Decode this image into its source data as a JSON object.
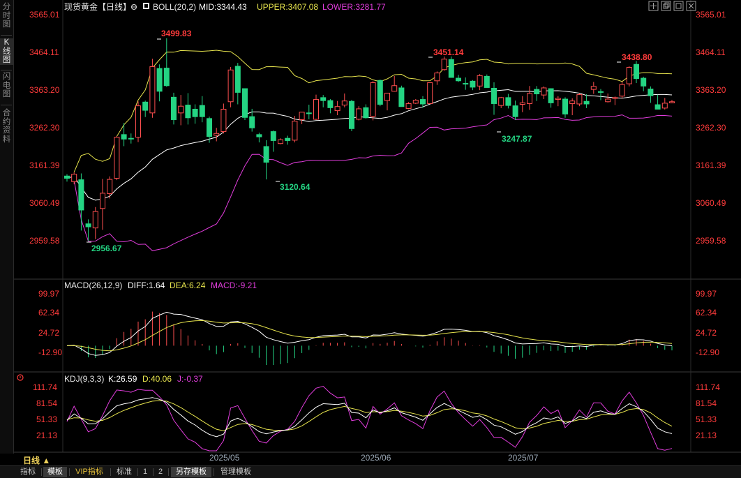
{
  "sidebar": {
    "tabs": [
      {
        "label": "分时图",
        "active": false
      },
      {
        "label": "K线图",
        "active": true
      },
      {
        "label": "闪电图",
        "active": false
      },
      {
        "label": "合约资料",
        "active": false
      }
    ]
  },
  "period_selector": "日线 ▲",
  "bottom_tabs": [
    {
      "label": "指标",
      "selected": false,
      "vip": false
    },
    {
      "label": "模板",
      "selected": true,
      "vip": false
    },
    {
      "label": "VIP指标",
      "selected": false,
      "vip": true
    },
    {
      "label": "标准",
      "selected": false,
      "vip": false
    },
    {
      "label": "1",
      "selected": false,
      "vip": false
    },
    {
      "label": "2",
      "selected": false,
      "vip": false
    },
    {
      "label": "另存模板",
      "selected": true,
      "vip": false
    },
    {
      "label": "管理模板",
      "selected": false,
      "vip": false
    }
  ],
  "window_controls": [
    "crosshair-icon",
    "restore-icon",
    "maximize-icon",
    "close-icon"
  ],
  "colors": {
    "up": "#ff4f4f",
    "down": "#24d483",
    "mid": "#ffffff",
    "upper": "#e6e34d",
    "lower": "#e13ddc",
    "axis_label": "#ff3b3b",
    "date_label": "#9aa7b4"
  },
  "main_panel": {
    "title": "现货黄金【日线】",
    "indicator_name": "BOLL(20,2)",
    "mid_label": "MID:3344.43",
    "upper_label": "UPPER:3407.08",
    "lower_label": "LOWER:3281.77",
    "y_ticks": [
      "3565.01",
      "3464.11",
      "3363.20",
      "3262.30",
      "3161.39",
      "3060.49",
      "2959.58"
    ],
    "annotations": [
      "3499.83",
      "2956.67",
      "3120.64",
      "3451.14",
      "3247.87",
      "3438.80"
    ]
  },
  "macd_panel": {
    "name": "MACD(26,12,9)",
    "diff_label": "DIFF:1.64",
    "dea_label": "DEA:6.24",
    "macd_label": "MACD:-9.21",
    "y_ticks": [
      "99.97",
      "62.34",
      "24.72",
      "-12.90"
    ]
  },
  "kdj_panel": {
    "name": "KDJ(9,3,3)",
    "k_label": "K:26.59",
    "d_label": "D:40.06",
    "j_label": "J:-0.37",
    "y_ticks": [
      "111.74",
      "81.54",
      "51.33",
      "21.13"
    ]
  },
  "x_labels": [
    "2025/05",
    "2025/06",
    "2025/07"
  ],
  "chart_data": {
    "type": "candlestick",
    "symbol": "现货黄金",
    "period": "日线",
    "ylim": [
      2900,
      3600
    ],
    "candles": [
      [
        3131,
        3136,
        3116,
        3125
      ],
      [
        3116,
        3141,
        3109,
        3136
      ],
      [
        3121,
        3138,
        2985,
        3040
      ],
      [
        3003,
        3015,
        2957,
        2995
      ],
      [
        2992,
        3048,
        2962,
        3036
      ],
      [
        3044,
        3123,
        2987,
        3085
      ],
      [
        3084,
        3130,
        3071,
        3122
      ],
      [
        3125,
        3238,
        3120,
        3235
      ],
      [
        3242,
        3273,
        3211,
        3230
      ],
      [
        3232,
        3245,
        3218,
        3230
      ],
      [
        3235,
        3331,
        3222,
        3319
      ],
      [
        3329,
        3333,
        3289,
        3307
      ],
      [
        3300,
        3445,
        3287,
        3424
      ],
      [
        3419,
        3430,
        3331,
        3358
      ],
      [
        3420,
        3500,
        3370,
        3373
      ],
      [
        3342,
        3354,
        3269,
        3282
      ],
      [
        3300,
        3348,
        3267,
        3318
      ],
      [
        3321,
        3353,
        3269,
        3287
      ],
      [
        3310,
        3323,
        3271,
        3290
      ],
      [
        3320,
        3345,
        3275,
        3290
      ],
      [
        3285,
        3290,
        3220,
        3237
      ],
      [
        3240,
        3260,
        3224,
        3245
      ],
      [
        3250,
        3325,
        3245,
        3310
      ],
      [
        3330,
        3423,
        3315,
        3415
      ],
      [
        3425,
        3434,
        3323,
        3355
      ],
      [
        3365,
        3365,
        3281,
        3288
      ],
      [
        3290,
        3311,
        3250,
        3260
      ],
      [
        3242,
        3247,
        3221,
        3236
      ],
      [
        3210,
        3227,
        3122,
        3168
      ],
      [
        3250,
        3253,
        3196,
        3226
      ],
      [
        3218,
        3232,
        3216,
        3228
      ],
      [
        3232,
        3239,
        3215,
        3226
      ],
      [
        3227,
        3292,
        3221,
        3278
      ],
      [
        3282,
        3302,
        3270,
        3302
      ],
      [
        3300,
        3322,
        3283,
        3298
      ],
      [
        3283,
        3349,
        3281,
        3336
      ],
      [
        3341,
        3348,
        3315,
        3333
      ],
      [
        3333,
        3337,
        3299,
        3314
      ],
      [
        3306,
        3332,
        3294,
        3317
      ],
      [
        3321,
        3352,
        3315,
        3332
      ],
      [
        3331,
        3335,
        3251,
        3258
      ],
      [
        3283,
        3318,
        3280,
        3311
      ],
      [
        3314,
        3323,
        3285,
        3287
      ],
      [
        3291,
        3385,
        3280,
        3381
      ],
      [
        3387,
        3389,
        3318,
        3323
      ],
      [
        3333,
        3353,
        3307,
        3353
      ],
      [
        3358,
        3399,
        3357,
        3373
      ],
      [
        3367,
        3373,
        3317,
        3317
      ],
      [
        3312,
        3329,
        3310,
        3325
      ],
      [
        3326,
        3337,
        3324,
        3334
      ],
      [
        3336,
        3345,
        3314,
        3324
      ],
      [
        3325,
        3381,
        3325,
        3381
      ],
      [
        3386,
        3411,
        3375,
        3407
      ],
      [
        3416,
        3451,
        3413,
        3444
      ],
      [
        3443,
        3451,
        3396,
        3395
      ],
      [
        3393,
        3402,
        3383,
        3386
      ],
      [
        3379,
        3395,
        3362,
        3378
      ],
      [
        3385,
        3388,
        3361,
        3369
      ],
      [
        3372,
        3404,
        3361,
        3400
      ],
      [
        3398,
        3403,
        3368,
        3368
      ],
      [
        3366,
        3382,
        3295,
        3325
      ],
      [
        3320,
        3343,
        3313,
        3341
      ],
      [
        3341,
        3351,
        3312,
        3320
      ],
      [
        3319,
        3333,
        3281,
        3290
      ],
      [
        3323,
        3345,
        3302,
        3327
      ],
      [
        3325,
        3372,
        3308,
        3352
      ],
      [
        3363,
        3372,
        3332,
        3351
      ],
      [
        3348,
        3371,
        3337,
        3367
      ],
      [
        3365,
        3366,
        3314,
        3327
      ],
      [
        3336,
        3345,
        3318,
        3339
      ],
      [
        3337,
        3342,
        3287,
        3297
      ],
      [
        3325,
        3339,
        3294,
        3332
      ],
      [
        3324,
        3353,
        3318,
        3349
      ],
      [
        3331,
        3350,
        3313,
        3324
      ],
      [
        3363,
        3383,
        3351,
        3371
      ],
      [
        3357,
        3364,
        3334,
        3355
      ],
      [
        3330,
        3352,
        3328,
        3337
      ],
      [
        3339,
        3344,
        3321,
        3341
      ],
      [
        3345,
        3384,
        3339,
        3376
      ],
      [
        3378,
        3425,
        3371,
        3422
      ],
      [
        3430,
        3439,
        3380,
        3392
      ],
      [
        3393,
        3397,
        3358,
        3372
      ],
      [
        3364,
        3371,
        3327,
        3346
      ],
      [
        3322,
        3349,
        3310,
        3310
      ],
      [
        3313,
        3340,
        3309,
        3326
      ],
      [
        3327,
        3335,
        3326,
        3330
      ]
    ]
  }
}
